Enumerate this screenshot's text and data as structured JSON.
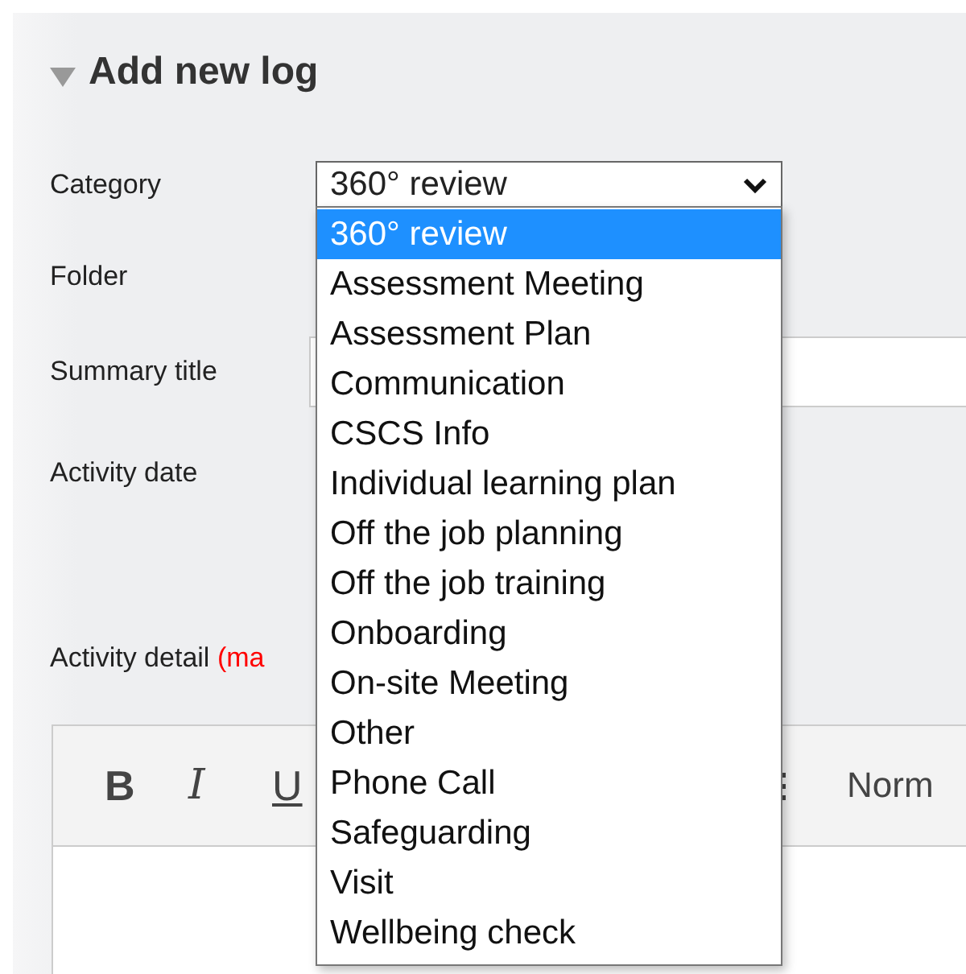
{
  "section": {
    "title": "Add new log",
    "expanded": true
  },
  "category": {
    "label": "Category",
    "value": "360° review",
    "options": [
      {
        "label": "360° review",
        "selected": true
      },
      {
        "label": "Assessment Meeting",
        "selected": false
      },
      {
        "label": "Assessment Plan",
        "selected": false
      },
      {
        "label": "Communication",
        "selected": false
      },
      {
        "label": "CSCS Info",
        "selected": false
      },
      {
        "label": "Individual learning plan",
        "selected": false
      },
      {
        "label": "Off the job planning",
        "selected": false
      },
      {
        "label": "Off the job training",
        "selected": false
      },
      {
        "label": "Onboarding",
        "selected": false
      },
      {
        "label": "On-site Meeting",
        "selected": false
      },
      {
        "label": "Other",
        "selected": false
      },
      {
        "label": "Phone Call",
        "selected": false
      },
      {
        "label": "Safeguarding",
        "selected": false
      },
      {
        "label": "Visit",
        "selected": false
      },
      {
        "label": "Wellbeing check",
        "selected": false
      }
    ]
  },
  "folder": {
    "label": "Folder"
  },
  "summary_title": {
    "label": "Summary title"
  },
  "activity_date": {
    "label": "Activity date"
  },
  "activity_detail": {
    "label": "Activity detail",
    "note": "(ma"
  },
  "editor": {
    "toolbar": [
      {
        "kind": "bold",
        "label": "B"
      },
      {
        "kind": "italic",
        "label": "I"
      },
      {
        "kind": "underline",
        "label": "U"
      }
    ],
    "format": "Norm"
  }
}
